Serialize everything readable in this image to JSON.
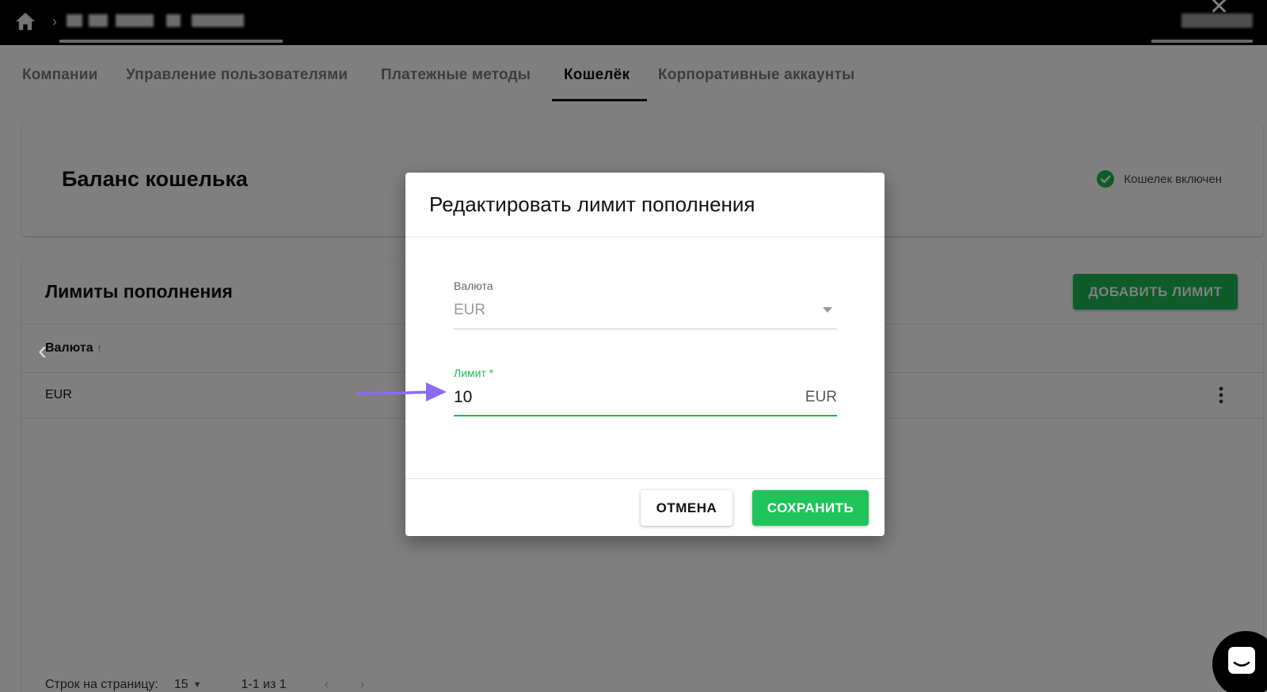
{
  "tabs": [
    {
      "label": "Компании"
    },
    {
      "label": "Управление пользователями"
    },
    {
      "label": "Платежные методы"
    },
    {
      "label": "Кошелёк"
    },
    {
      "label": "Корпоративные аккаунты"
    }
  ],
  "balance": {
    "title": "Баланс кошелька",
    "status": "Кошелек включен"
  },
  "limits": {
    "title": "Лимиты пополнения",
    "add_button": "ДОБАВИТЬ ЛИМИТ",
    "column_currency": "Валюта",
    "row_currency": "EUR",
    "rows_per_page_label": "Строк на страницу:",
    "rows_per_page_value": "15",
    "range": "1-1 из 1"
  },
  "dialog": {
    "title": "Редактировать лимит пополнения",
    "currency_label": "Валюта",
    "currency_value": "EUR",
    "limit_label": "Лимит *",
    "limit_value": "10",
    "limit_suffix": "EUR",
    "cancel_label": "ОТМЕНА",
    "save_label": "СОХРАНИТЬ"
  },
  "colors": {
    "accent": "#1db954",
    "pointer": "#8b6cf0"
  }
}
